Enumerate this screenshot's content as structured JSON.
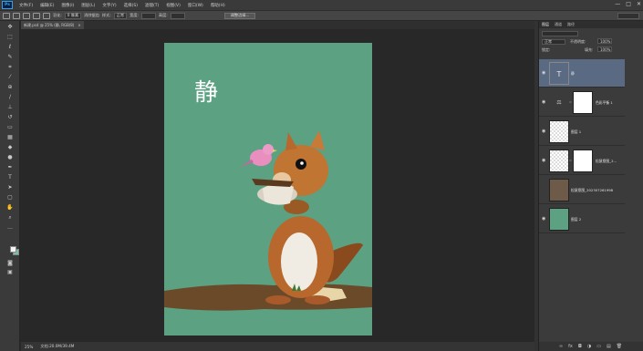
{
  "app": {
    "logo": "Ps",
    "menu": [
      "文件(F)",
      "编辑(E)",
      "图像(I)",
      "图层(L)",
      "文字(Y)",
      "选择(S)",
      "滤镜(T)",
      "视图(V)",
      "窗口(W)",
      "帮助(H)"
    ],
    "window_controls": [
      "—",
      "□",
      "✕"
    ]
  },
  "options": {
    "feather_label": "羽化:",
    "feather_value": "0 像素",
    "antialias_label": "消除锯齿",
    "style_label": "样式:",
    "style_value": "正常",
    "width_label": "宽度:",
    "height_label": "高度:",
    "refine_button": "调整边缘..."
  },
  "document": {
    "tab_label": "新建.psd @ 25% (静, RGB/8)",
    "close": "×",
    "canvas_text": "静"
  },
  "status": {
    "zoom": "25%",
    "info": "文档:20.0M/39.4M"
  },
  "toolbar": {
    "tools": [
      {
        "name": "move-tool-icon",
        "glyph": "✥"
      },
      {
        "name": "marquee-tool-icon",
        "glyph": "⬚"
      },
      {
        "name": "lasso-tool-icon",
        "glyph": "ℓ"
      },
      {
        "name": "quick-select-tool-icon",
        "glyph": "✎"
      },
      {
        "name": "crop-tool-icon",
        "glyph": "⌗"
      },
      {
        "name": "eyedropper-tool-icon",
        "glyph": "⁄"
      },
      {
        "name": "healing-brush-tool-icon",
        "glyph": "⊕"
      },
      {
        "name": "brush-tool-icon",
        "glyph": "∕"
      },
      {
        "name": "clone-stamp-tool-icon",
        "glyph": "⊥"
      },
      {
        "name": "history-brush-tool-icon",
        "glyph": "↺"
      },
      {
        "name": "eraser-tool-icon",
        "glyph": "▭"
      },
      {
        "name": "gradient-tool-icon",
        "glyph": "▦"
      },
      {
        "name": "blur-tool-icon",
        "glyph": "◆"
      },
      {
        "name": "dodge-tool-icon",
        "glyph": "●"
      },
      {
        "name": "pen-tool-icon",
        "glyph": "✒"
      },
      {
        "name": "type-tool-icon",
        "glyph": "T"
      },
      {
        "name": "path-select-tool-icon",
        "glyph": "➤"
      },
      {
        "name": "shape-tool-icon",
        "glyph": "▢"
      },
      {
        "name": "hand-tool-icon",
        "glyph": "✋"
      },
      {
        "name": "zoom-tool-icon",
        "glyph": "⌕"
      },
      {
        "name": "extra-tool-icon",
        "glyph": "…"
      }
    ],
    "mode_icons": [
      "◙",
      "▣"
    ],
    "colors": {
      "foreground": "#f4f4f4",
      "background": "#7cc0a8"
    }
  },
  "layers": {
    "tabs": [
      "图层",
      "通道",
      "路径"
    ],
    "blend_mode": "正常",
    "opacity_label": "不透明度:",
    "opacity_value": "100%",
    "fill_label": "填充:",
    "fill_value": "100%",
    "lock_label": "锁定:",
    "items": [
      {
        "name": "静",
        "type": "text",
        "visible": true,
        "selected": true
      },
      {
        "name": "色彩平衡 1",
        "type": "adjustment",
        "visible": true,
        "selected": false
      },
      {
        "name": "图层 1",
        "type": "pixel",
        "visible": true,
        "selected": false
      },
      {
        "name": "松鼠抠图_2...",
        "type": "pixel-mask",
        "visible": true,
        "selected": false
      },
      {
        "name": "松鼠抠图_202307261998",
        "type": "photo",
        "visible": false,
        "selected": false
      },
      {
        "name": "图层 2",
        "type": "fill",
        "visible": true,
        "selected": false
      }
    ],
    "footer_icons": [
      "link-icon",
      "fx-icon",
      "mask-icon",
      "adjustment-icon",
      "group-icon",
      "new-layer-icon",
      "trash-icon"
    ],
    "footer_glyphs": [
      "∞",
      "fx",
      "◘",
      "◑",
      "▭",
      "▤",
      "🗑"
    ]
  },
  "colors": {
    "canvas_bg": "#5ba182",
    "selected_layer": "#5a6a82",
    "ui_dark": "#282828"
  }
}
